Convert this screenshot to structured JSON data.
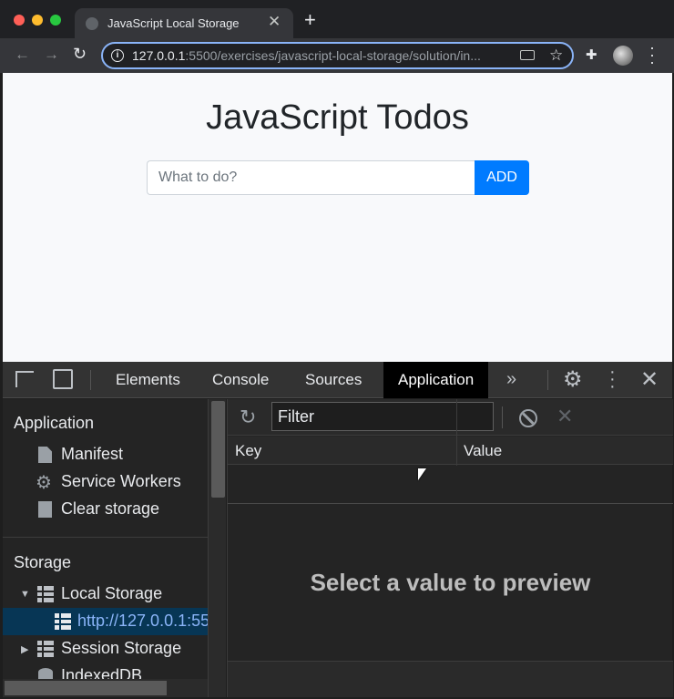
{
  "browser": {
    "tab_title": "JavaScript Local Storage",
    "tab_close": "✕",
    "new_tab": "+",
    "url_host": "127.0.0.1",
    "url_rest": ":5500/exercises/javascript-local-storage/solution/in...",
    "icons": [
      "back-icon",
      "forward-icon",
      "reload-icon",
      "info-icon",
      "cast-icon",
      "star-icon",
      "extensions-icon",
      "avatar",
      "menu-icon"
    ]
  },
  "page": {
    "title": "JavaScript Todos",
    "input_placeholder": "What to do?",
    "add_label": "ADD",
    "accent": "#007bff"
  },
  "devtools": {
    "tabs": [
      "Elements",
      "Console",
      "Sources",
      "Application"
    ],
    "active_tab": "Application",
    "more": "»",
    "sidebar": {
      "application_heading": "Application",
      "application_items": [
        "Manifest",
        "Service Workers",
        "Clear storage"
      ],
      "storage_heading": "Storage",
      "storage_items": [
        "Local Storage",
        "http://127.0.0.1:55",
        "Session Storage",
        "IndexedDB"
      ],
      "selected": "http://127.0.0.1:55"
    },
    "filter_placeholder": "Filter",
    "columns": [
      "Key",
      "Value"
    ],
    "preview_text": "Select a value to preview"
  }
}
